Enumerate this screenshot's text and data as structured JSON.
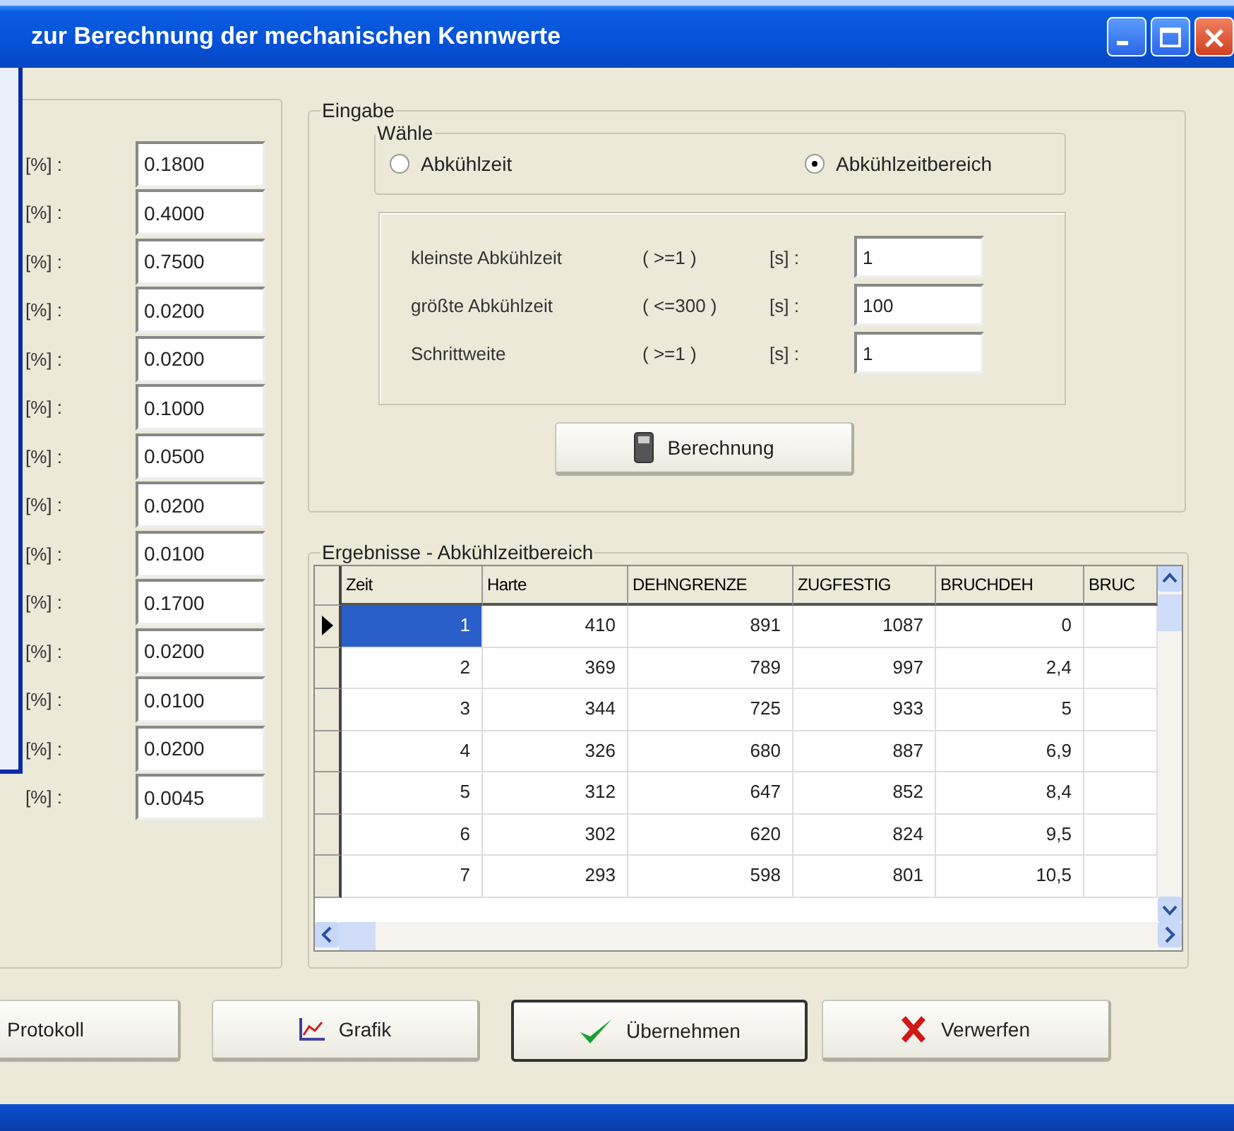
{
  "window": {
    "title": "zur Berechnung der mechanischen Kennwerte"
  },
  "composition": {
    "rows": [
      {
        "unit": "[%] :",
        "value": "0.1800"
      },
      {
        "unit": "[%] :",
        "value": "0.4000"
      },
      {
        "unit": "[%] :",
        "value": "0.7500"
      },
      {
        "unit": "[%] :",
        "value": "0.0200"
      },
      {
        "unit": "[%] :",
        "value": "0.0200"
      },
      {
        "unit": "[%] :",
        "value": "0.1000"
      },
      {
        "unit": "[%] :",
        "value": "0.0500"
      },
      {
        "unit": "[%] :",
        "value": "0.0200"
      },
      {
        "unit": "[%] :",
        "value": "0.0100"
      },
      {
        "unit": "[%] :",
        "value": "0.1700"
      },
      {
        "unit": "[%] :",
        "value": "0.0200"
      },
      {
        "unit": "[%] :",
        "value": "0.0100"
      },
      {
        "unit": "[%] :",
        "value": "0.0200"
      },
      {
        "unit": "[%] :",
        "value": "0.0045"
      }
    ]
  },
  "input": {
    "title": "Eingabe",
    "mode": {
      "title": "Wähle",
      "options": [
        {
          "label": "Abkühlzeit",
          "selected": false
        },
        {
          "label": "Abkühlzeitbereich",
          "selected": true
        }
      ]
    },
    "params": [
      {
        "label": "kleinste Abkühlzeit",
        "limit": "( >=1 )",
        "unit": "[s] :",
        "value": "1"
      },
      {
        "label": "größte Abkühlzeit",
        "limit": "( <=300 )",
        "unit": "[s] :",
        "value": "100"
      },
      {
        "label": "Schrittweite",
        "limit": "( >=1 )",
        "unit": "[s] :",
        "value": "1"
      }
    ],
    "calculate_button": "Berechnung"
  },
  "results": {
    "title": "Ergebnisse - Abkühlzeitbereich",
    "columns": [
      "Zeit",
      "Harte",
      "DEHNGRENZE",
      "ZUGFESTIG",
      "BRUCHDEH",
      "BRUC"
    ],
    "rows": [
      {
        "selected": true,
        "cells": [
          "1",
          "410",
          "891",
          "1087",
          "0"
        ]
      },
      {
        "selected": false,
        "cells": [
          "2",
          "369",
          "789",
          "997",
          "2,4"
        ]
      },
      {
        "selected": false,
        "cells": [
          "3",
          "344",
          "725",
          "933",
          "5"
        ]
      },
      {
        "selected": false,
        "cells": [
          "4",
          "326",
          "680",
          "887",
          "6,9"
        ]
      },
      {
        "selected": false,
        "cells": [
          "5",
          "312",
          "647",
          "852",
          "8,4"
        ]
      },
      {
        "selected": false,
        "cells": [
          "6",
          "302",
          "620",
          "824",
          "9,5"
        ]
      },
      {
        "selected": false,
        "cells": [
          "7",
          "293",
          "598",
          "801",
          "10,5"
        ]
      }
    ]
  },
  "buttons": [
    {
      "label": "Protokoll",
      "kind": "plain"
    },
    {
      "label": "Grafik",
      "kind": "chart"
    },
    {
      "label": "Übernehmen",
      "kind": "accept"
    },
    {
      "label": "Verwerfen",
      "kind": "discard"
    }
  ]
}
